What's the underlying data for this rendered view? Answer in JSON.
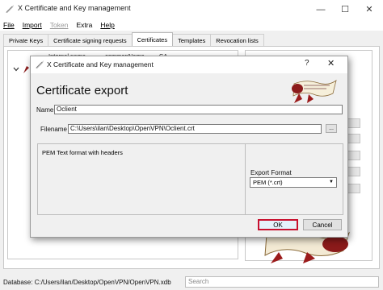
{
  "window": {
    "title": "X Certificate and Key management",
    "controls": {
      "minimize": "—",
      "maximize": "☐",
      "close": "✕"
    }
  },
  "menu": [
    {
      "label": "File",
      "enabled": true
    },
    {
      "label": "Import",
      "enabled": true
    },
    {
      "label": "Token",
      "enabled": false
    },
    {
      "label": "Extra",
      "enabled": true
    },
    {
      "label": "Help",
      "enabled": true
    }
  ],
  "tabs": [
    {
      "label": "Private Keys",
      "active": false
    },
    {
      "label": "Certificate signing requests",
      "active": false
    },
    {
      "label": "Certificates",
      "active": true
    },
    {
      "label": "Templates",
      "active": false
    },
    {
      "label": "Revocation lists",
      "active": false
    }
  ],
  "tree": {
    "columns": [
      "Internal name",
      "commonName",
      "CA"
    ]
  },
  "dialog": {
    "title": "X Certificate and Key management",
    "help": "?",
    "close": "✕",
    "heading": "Certificate export",
    "name_label": "Name",
    "name_value": "Oclient",
    "filename_label": "Filename",
    "filename_value": "C:\\Users\\ilan\\Desktop\\OpenVPN\\Oclient.crt",
    "browse_label": "...",
    "format_description": "PEM Text format with headers",
    "export_format_label": "Export Format",
    "export_format_value": "PEM (*.crt)",
    "ok_label": "OK",
    "cancel_label": "Cancel"
  },
  "status": {
    "database": "Database: C:/Users/ilan/Desktop/OpenVPN/OpenVPN.xdb",
    "search_placeholder": "Search"
  },
  "colors": {
    "ok_highlight": "#c8102e",
    "seal_red": "#9b1b1b"
  }
}
